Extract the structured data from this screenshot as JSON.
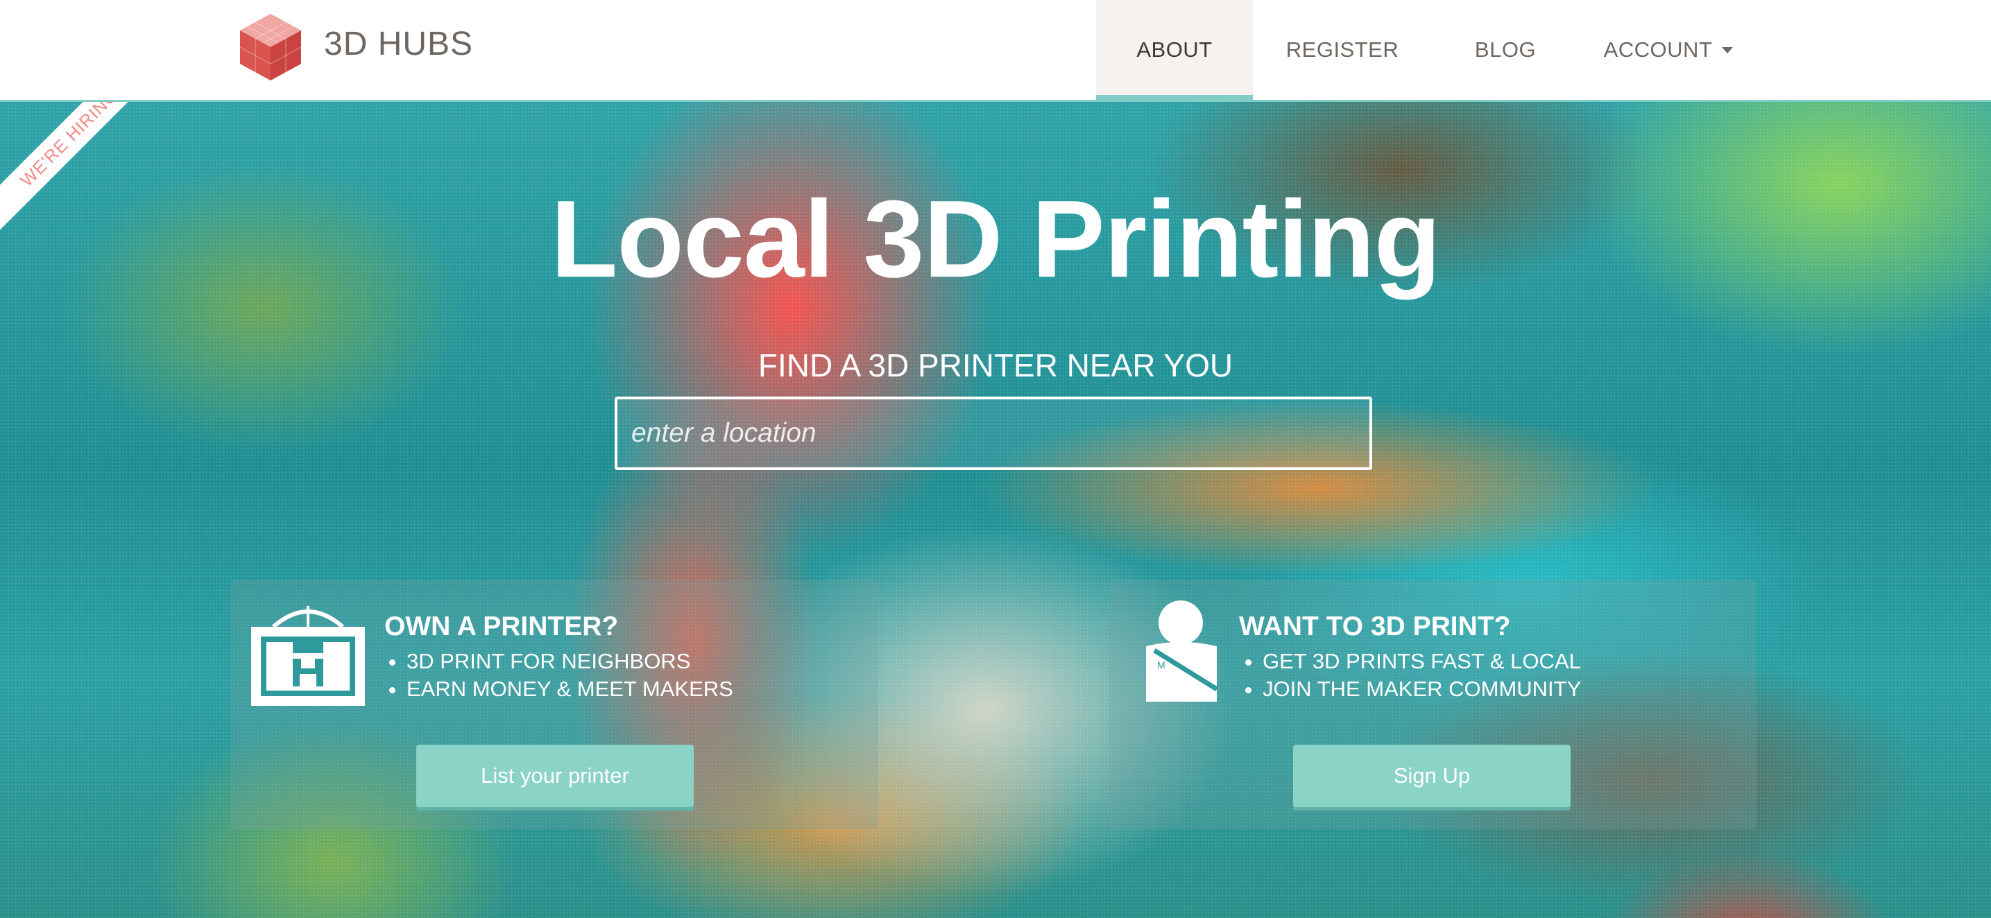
{
  "header": {
    "brand": "3D HUBS",
    "nav": [
      {
        "label": "ABOUT",
        "active": true
      },
      {
        "label": "REGISTER"
      },
      {
        "label": "BLOG"
      },
      {
        "label": "ACCOUNT"
      }
    ],
    "logo_icon": "cube-mosaic-icon"
  },
  "hero": {
    "ribbon": "WE'RE HIRING",
    "title": "Local 3D Printing",
    "subtitle": "FIND A 3D PRINTER NEAR YOU",
    "search_placeholder": "enter a location"
  },
  "cards": [
    {
      "icon": "printer-icon",
      "title": "OWN A PRINTER?",
      "items": [
        "3D PRINT FOR NEIGHBORS",
        "EARN MONEY & MEET MAKERS"
      ],
      "button": "List your printer"
    },
    {
      "icon": "maker-person-icon",
      "title": "WANT TO 3D PRINT?",
      "items": [
        "GET 3D PRINTS FAST & LOCAL",
        "JOIN THE MAKER COMMUNITY"
      ],
      "button": "Sign Up"
    }
  ],
  "colors": {
    "accent": "#7fcdc5",
    "button": "#8ad3c6",
    "ribbon_text": "#ef8a86",
    "logo_red": "#d9534f"
  }
}
